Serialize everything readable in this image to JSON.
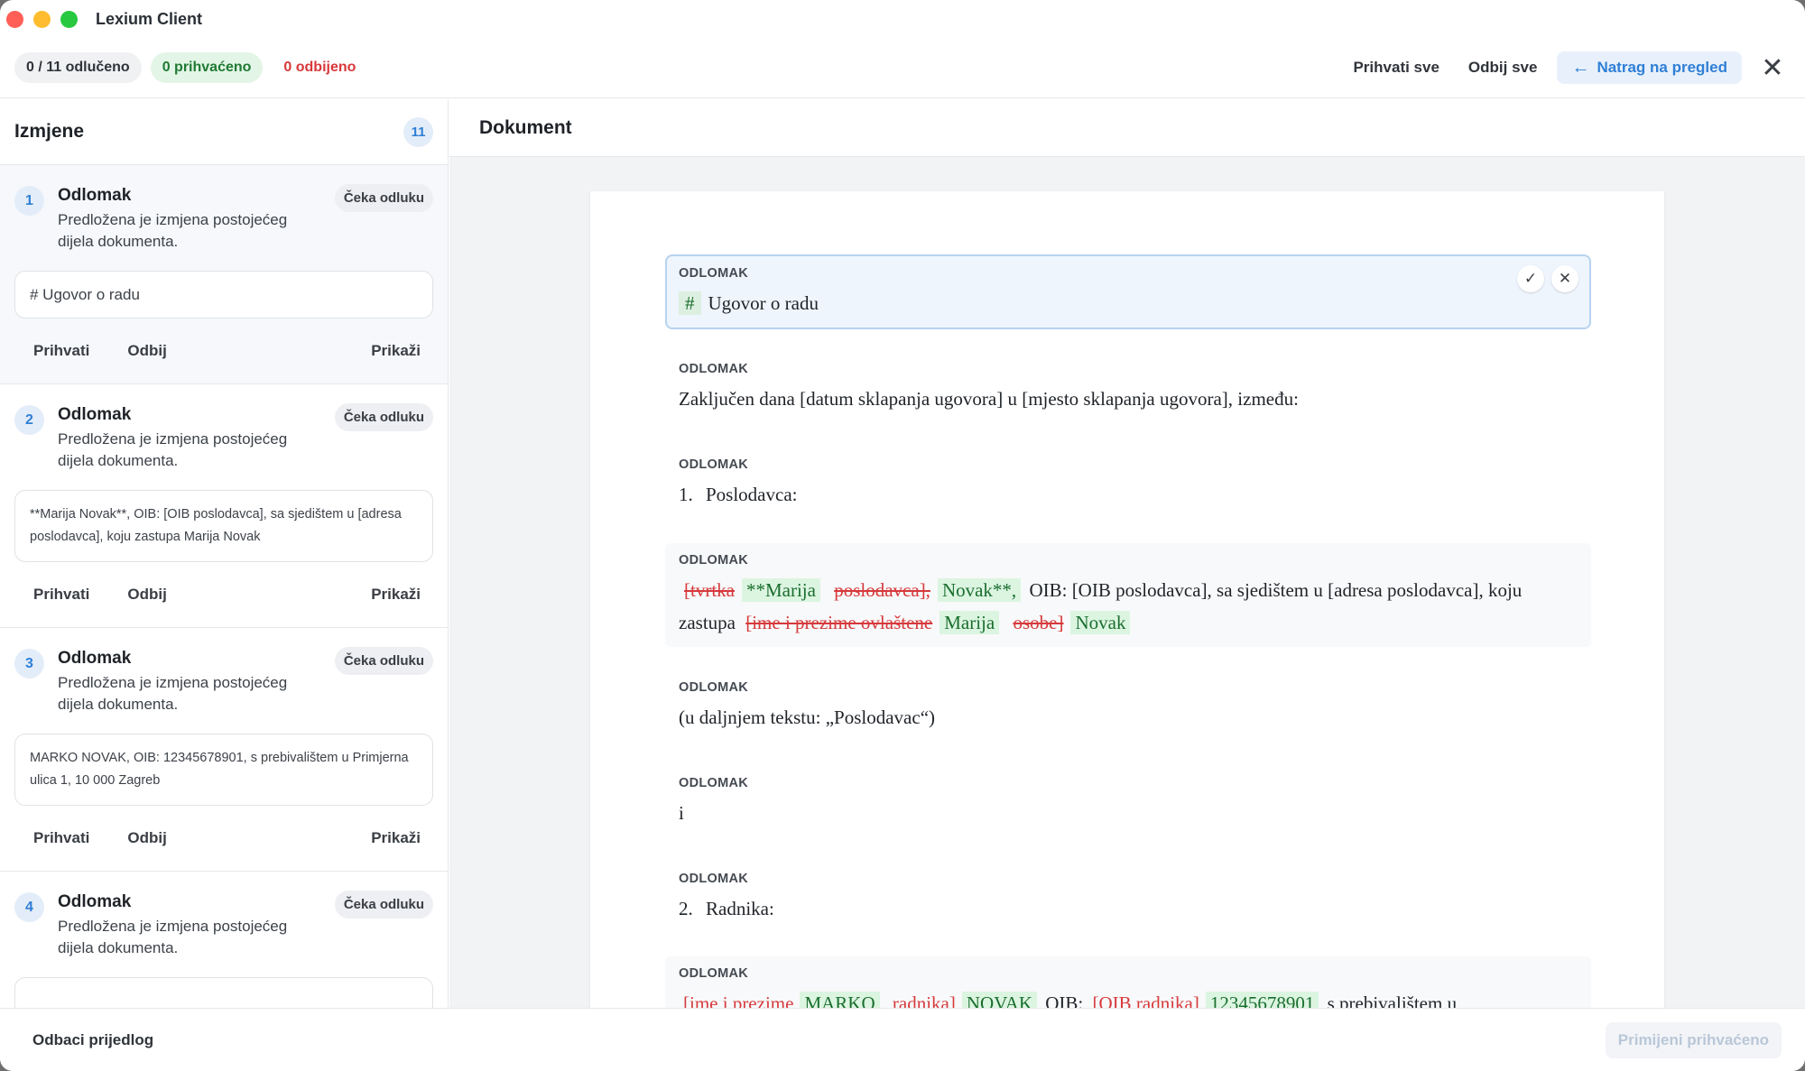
{
  "window": {
    "title": "Lexium Client"
  },
  "toolbar": {
    "decided": "0 / 11 odlučeno",
    "accepted": "0 prihvaćeno",
    "rejected": "0 odbijeno",
    "accept_all": "Prihvati sve",
    "reject_all": "Odbij sve",
    "back_arrow": "←",
    "back_label": "Natrag na pregled",
    "close_glyph": "✕"
  },
  "sidebar": {
    "title": "Izmjene",
    "count": "11",
    "cards": [
      {
        "num": "1",
        "title": "Odlomak",
        "desc": "Predložena je izmjena postojećeg dijela dokumenta.",
        "status": "Čeka odluku",
        "preview": "# Ugovor o radu",
        "accept": "Prihvati",
        "reject": "Odbij",
        "show": "Prikaži"
      },
      {
        "num": "2",
        "title": "Odlomak",
        "desc": "Predložena je izmjena postojećeg dijela dokumenta.",
        "status": "Čeka odluku",
        "preview": "**Marija Novak**, OIB: [OIB poslodavca], sa sjedištem u [adresa poslodavca], koju zastupa Marija Novak",
        "accept": "Prihvati",
        "reject": "Odbij",
        "show": "Prikaži"
      },
      {
        "num": "3",
        "title": "Odlomak",
        "desc": "Predložena je izmjena postojećeg dijela dokumenta.",
        "status": "Čeka odluku",
        "preview": "MARKO NOVAK, OIB: 12345678901, s prebivalištem u Primjerna ulica 1, 10 000 Zagreb",
        "accept": "Prihvati",
        "reject": "Odbij",
        "show": "Prikaži"
      },
      {
        "num": "4",
        "title": "Odlomak",
        "desc": "Predložena je izmjena postojećeg dijela dokumenta.",
        "status": "Čeka odluku"
      }
    ]
  },
  "document": {
    "title": "Dokument",
    "para_label": "ODLOMAK",
    "p1": {
      "hash": "#",
      "text": "Ugovor o radu",
      "accept_glyph": "✓",
      "reject_glyph": "✕"
    },
    "p2": {
      "text": "Zaključen dana [datum sklapanja ugovora] u [mjesto sklapanja ugovora], između:"
    },
    "p3": {
      "num": "1.",
      "text": "Poslodavca:"
    },
    "p4": {
      "del1": "[tvrtka",
      "ins1": "**Marija",
      "del2": "poslodavca],",
      "ins2": "Novak**,",
      "mid": "OIB: [OIB poslodavca], sa sjedištem u [adresa poslodavca], koju zastupa",
      "del3": "[ime i prezime ovlaštene",
      "ins3": "Marija",
      "del4": "osobe]",
      "ins4": "Novak"
    },
    "p5": {
      "text": "(u daljnjem tekstu: „Poslodavac“)"
    },
    "p6": {
      "text": "i"
    },
    "p7": {
      "num": "2.",
      "text": "Radnika:"
    },
    "p8": {
      "del1": "[ime i prezime",
      "ins1": "MARKO",
      "del2": "radnika]",
      "ins2": "NOVAK",
      "mid1": "OIB:",
      "del3": "[OIB radnika]",
      "ins3": "12345678901",
      "mid2": "s prebivalištem u"
    }
  },
  "bottombar": {
    "discard": "Odbaci prijedlog",
    "apply": "Primijeni prihvaćeno"
  }
}
